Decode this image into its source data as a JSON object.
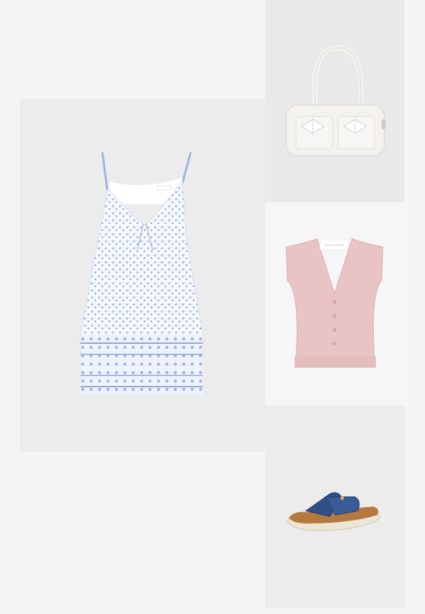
{
  "board": {
    "items": [
      {
        "name": "floral-mini-dress",
        "label": ""
      },
      {
        "name": "white-bow-shoulder-bag",
        "label": ""
      },
      {
        "name": "pink-knit-vest",
        "label": ""
      },
      {
        "name": "denim-crossover-sandal",
        "label": ""
      }
    ]
  },
  "colors": {
    "page_bg": "#f5f5f5",
    "dress_blue": "#8ea6d8",
    "bag_white": "#f4f2ee",
    "vest_pink": "#e9c4c4",
    "sandal_denim": "#2f4f86",
    "sandal_footbed": "#b5793e"
  }
}
